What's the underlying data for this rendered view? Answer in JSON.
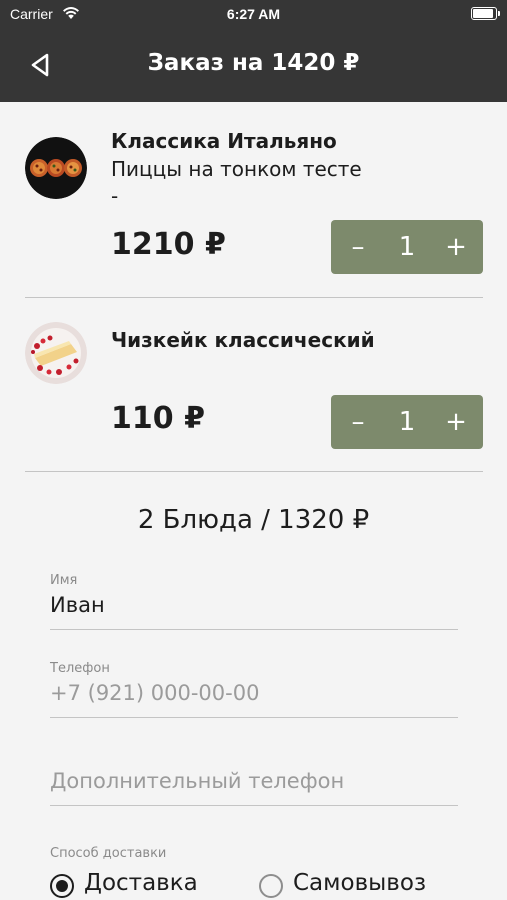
{
  "status_bar": {
    "carrier": "Carrier",
    "time": "6:27 AM"
  },
  "nav": {
    "title": "Заказ на 1420 ₽"
  },
  "cart": {
    "items": [
      {
        "name": "Классика Итальяно",
        "description": "Пиццы на тонком тесте",
        "description_extra": "-",
        "price": "1210 ₽",
        "quantity": "1",
        "minus": "–",
        "plus": "+"
      },
      {
        "name": "Чизкейк классический",
        "price": "110 ₽",
        "quantity": "1",
        "minus": "–",
        "plus": "+"
      }
    ],
    "summary": "2 Блюда / 1320 ₽"
  },
  "form": {
    "name": {
      "label": "Имя",
      "value": "Иван"
    },
    "phone": {
      "label": "Телефон",
      "placeholder": "+7 (921) 000-00-00"
    },
    "extra_phone": {
      "placeholder": "Дополнительный телефон"
    },
    "delivery": {
      "label": "Способ доставки",
      "options": [
        {
          "label": "Доставка",
          "selected": true
        },
        {
          "label": "Самовывоз",
          "selected": false
        }
      ]
    }
  },
  "colors": {
    "header": "#363636",
    "stepper": "#7d8a6c",
    "background": "#f4f4f4"
  }
}
